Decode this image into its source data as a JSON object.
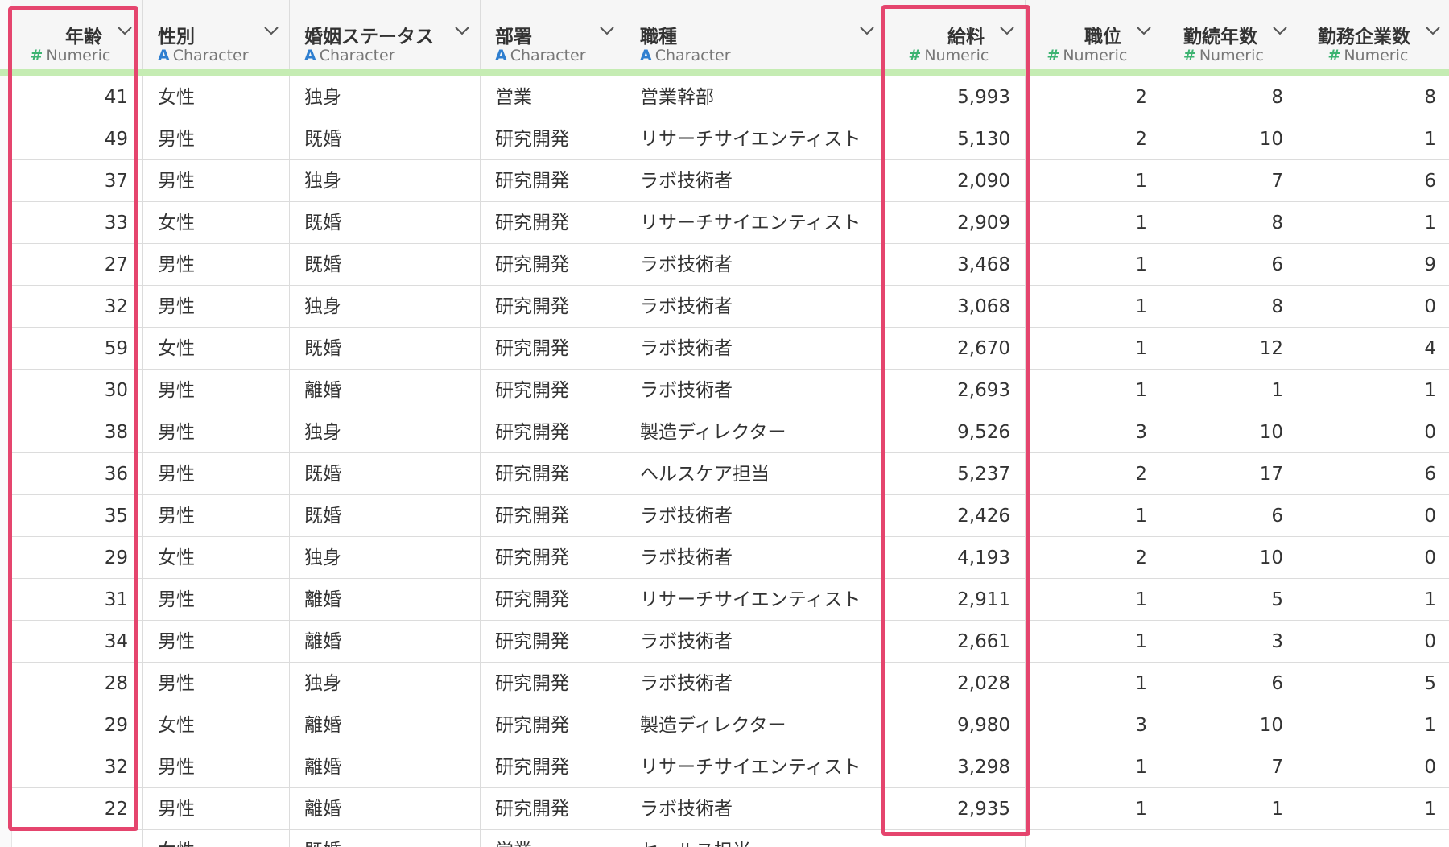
{
  "columns": [
    {
      "name": "年齢",
      "type": "Numeric",
      "kind": "num",
      "align": "r"
    },
    {
      "name": "性別",
      "type": "Character",
      "kind": "chr",
      "align": "l"
    },
    {
      "name": "婚姻ステータス",
      "type": "Character",
      "kind": "chr",
      "align": "l"
    },
    {
      "name": "部署",
      "type": "Character",
      "kind": "chr",
      "align": "l"
    },
    {
      "name": "職種",
      "type": "Character",
      "kind": "chr",
      "align": "l"
    },
    {
      "name": "給料",
      "type": "Numeric",
      "kind": "num",
      "align": "r"
    },
    {
      "name": "職位",
      "type": "Numeric",
      "kind": "num",
      "align": "r"
    },
    {
      "name": "勤続年数",
      "type": "Numeric",
      "kind": "num",
      "align": "r"
    },
    {
      "name": "勤務企業数",
      "type": "Numeric",
      "kind": "num",
      "align": "r"
    }
  ],
  "type_icons": {
    "Numeric": "#",
    "Character": "A"
  },
  "rows": [
    [
      "41",
      "女性",
      "独身",
      "営業",
      "営業幹部",
      "5,993",
      "2",
      "8",
      "8"
    ],
    [
      "49",
      "男性",
      "既婚",
      "研究開発",
      "リサーチサイエンティスト",
      "5,130",
      "2",
      "10",
      "1"
    ],
    [
      "37",
      "男性",
      "独身",
      "研究開発",
      "ラボ技術者",
      "2,090",
      "1",
      "7",
      "6"
    ],
    [
      "33",
      "女性",
      "既婚",
      "研究開発",
      "リサーチサイエンティスト",
      "2,909",
      "1",
      "8",
      "1"
    ],
    [
      "27",
      "男性",
      "既婚",
      "研究開発",
      "ラボ技術者",
      "3,468",
      "1",
      "6",
      "9"
    ],
    [
      "32",
      "男性",
      "独身",
      "研究開発",
      "ラボ技術者",
      "3,068",
      "1",
      "8",
      "0"
    ],
    [
      "59",
      "女性",
      "既婚",
      "研究開発",
      "ラボ技術者",
      "2,670",
      "1",
      "12",
      "4"
    ],
    [
      "30",
      "男性",
      "離婚",
      "研究開発",
      "ラボ技術者",
      "2,693",
      "1",
      "1",
      "1"
    ],
    [
      "38",
      "男性",
      "独身",
      "研究開発",
      "製造ディレクター",
      "9,526",
      "3",
      "10",
      "0"
    ],
    [
      "36",
      "男性",
      "既婚",
      "研究開発",
      "ヘルスケア担当",
      "5,237",
      "2",
      "17",
      "6"
    ],
    [
      "35",
      "男性",
      "既婚",
      "研究開発",
      "ラボ技術者",
      "2,426",
      "1",
      "6",
      "0"
    ],
    [
      "29",
      "女性",
      "独身",
      "研究開発",
      "ラボ技術者",
      "4,193",
      "2",
      "10",
      "0"
    ],
    [
      "31",
      "男性",
      "離婚",
      "研究開発",
      "リサーチサイエンティスト",
      "2,911",
      "1",
      "5",
      "1"
    ],
    [
      "34",
      "男性",
      "離婚",
      "研究開発",
      "ラボ技術者",
      "2,661",
      "1",
      "3",
      "0"
    ],
    [
      "28",
      "男性",
      "独身",
      "研究開発",
      "ラボ技術者",
      "2,028",
      "1",
      "6",
      "5"
    ],
    [
      "29",
      "女性",
      "離婚",
      "研究開発",
      "製造ディレクター",
      "9,980",
      "3",
      "10",
      "1"
    ],
    [
      "32",
      "男性",
      "離婚",
      "研究開発",
      "リサーチサイエンティスト",
      "3,298",
      "1",
      "7",
      "0"
    ],
    [
      "22",
      "男性",
      "離婚",
      "研究開発",
      "ラボ技術者",
      "2,935",
      "1",
      "1",
      "1"
    ]
  ],
  "partial_row": [
    "",
    "女性",
    "既婚",
    "営業",
    "セールス担当",
    "",
    "",
    "",
    ""
  ],
  "highlighted_columns": [
    "年齢",
    "給料"
  ],
  "colors": {
    "highlight": "#e5456e",
    "numeric_icon": "#3cb371",
    "character_icon": "#2f7fd0",
    "header_bar": "#c5ecb3"
  }
}
